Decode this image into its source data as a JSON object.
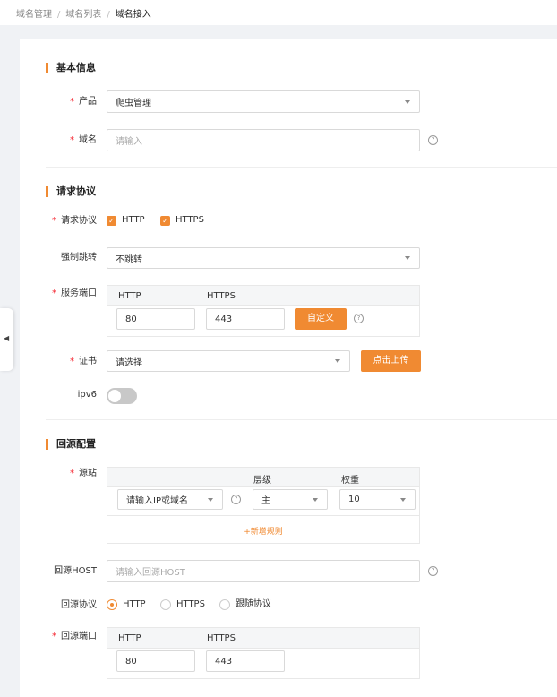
{
  "breadcrumb": {
    "items": [
      "域名管理",
      "域名列表"
    ],
    "current": "域名接入"
  },
  "basic": {
    "title": "基本信息",
    "product_label": "产品",
    "product_value": "爬虫管理",
    "domain_label": "域名",
    "domain_placeholder": "请输入"
  },
  "protocol": {
    "title": "请求协议",
    "req_label": "请求协议",
    "http_label": "HTTP",
    "https_label": "HTTPS",
    "redirect_label": "强制跳转",
    "redirect_value": "不跳转",
    "port_label": "服务端口",
    "port_col_http": "HTTP",
    "port_col_https": "HTTPS",
    "port_http_value": "80",
    "port_https_value": "443",
    "custom_button": "自定义",
    "cert_label": "证书",
    "cert_value": "请选择",
    "upload_button": "点击上传",
    "ipv6_label": "ipv6"
  },
  "origin": {
    "title": "回源配置",
    "source_label": "源站",
    "col_level": "层级",
    "col_weight": "权重",
    "source_placeholder": "请输入IP或域名",
    "level_value": "主",
    "weight_value": "10",
    "add_rule": "+新增规则",
    "host_label": "回源HOST",
    "host_placeholder": "请输入回源HOST",
    "proto_label": "回源协议",
    "proto_http": "HTTP",
    "proto_https": "HTTPS",
    "proto_follow": "跟随协议",
    "port_label": "回源端口",
    "port_col_http": "HTTP",
    "port_col_https": "HTTPS",
    "port_http_value": "80",
    "port_https_value": "443"
  },
  "colors": {
    "accent": "#f08a32",
    "required": "#f5222d"
  }
}
